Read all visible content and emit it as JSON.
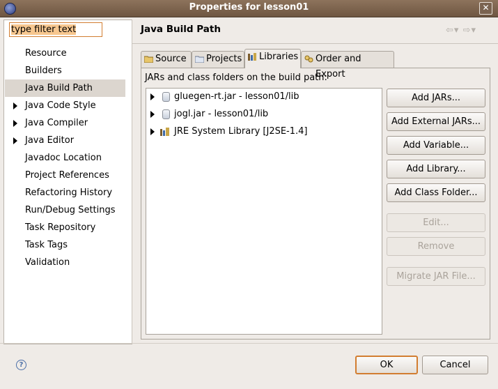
{
  "window": {
    "title": "Properties for lesson01"
  },
  "filter": {
    "value": "type filter text"
  },
  "sidebar": {
    "items": [
      {
        "label": "Resource",
        "expandable": false,
        "selected": false
      },
      {
        "label": "Builders",
        "expandable": false,
        "selected": false
      },
      {
        "label": "Java Build Path",
        "expandable": false,
        "selected": true
      },
      {
        "label": "Java Code Style",
        "expandable": true,
        "selected": false
      },
      {
        "label": "Java Compiler",
        "expandable": true,
        "selected": false
      },
      {
        "label": "Java Editor",
        "expandable": true,
        "selected": false
      },
      {
        "label": "Javadoc Location",
        "expandable": false,
        "selected": false
      },
      {
        "label": "Project References",
        "expandable": false,
        "selected": false
      },
      {
        "label": "Refactoring History",
        "expandable": false,
        "selected": false
      },
      {
        "label": "Run/Debug Settings",
        "expandable": false,
        "selected": false
      },
      {
        "label": "Task Repository",
        "expandable": false,
        "selected": false
      },
      {
        "label": "Task Tags",
        "expandable": false,
        "selected": false
      },
      {
        "label": "Validation",
        "expandable": false,
        "selected": false
      }
    ]
  },
  "page": {
    "title": "Java Build Path",
    "nav_back": "⇦▾",
    "nav_forward": "⇨▾"
  },
  "tabs": [
    {
      "label": "Source",
      "active": false
    },
    {
      "label": "Projects",
      "active": false
    },
    {
      "label": "Libraries",
      "active": true
    },
    {
      "label": "Order and Export",
      "active": false
    }
  ],
  "libraries": {
    "description": "JARs and class folders on the build path:",
    "entries": [
      {
        "label": "gluegen-rt.jar - lesson01/lib",
        "icon": "jar-icon"
      },
      {
        "label": "jogl.jar - lesson01/lib",
        "icon": "jar-icon"
      },
      {
        "label": "JRE System Library [J2SE-1.4]",
        "icon": "library-icon"
      }
    ]
  },
  "buttons": {
    "add_jars": "Add JARs...",
    "add_external_jars": "Add External JARs...",
    "add_variable": "Add Variable...",
    "add_library": "Add Library...",
    "add_class_folder": "Add Class Folder...",
    "edit": "Edit...",
    "remove": "Remove",
    "migrate_jar": "Migrate JAR File..."
  },
  "footer": {
    "ok": "OK",
    "cancel": "Cancel",
    "help": "?"
  },
  "colors": {
    "accent": "#d27d30",
    "titlebar": "#7d6450",
    "selection": "#dcd6cf"
  }
}
